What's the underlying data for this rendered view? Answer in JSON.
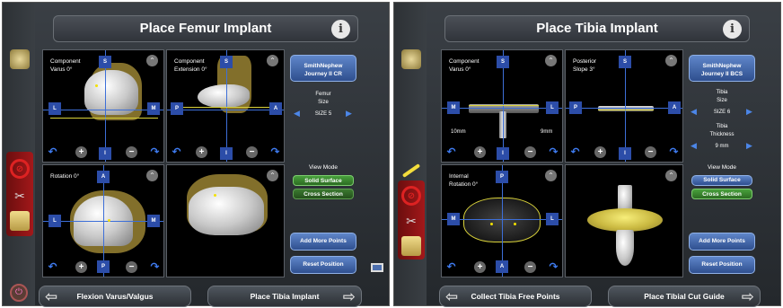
{
  "screens": [
    {
      "title": "Place Femur Implant",
      "implant": {
        "brand": "SmithNephew",
        "model": "Journey II CR"
      },
      "views": {
        "top_left": {
          "label": "Component\nVarus 0°",
          "axis_labels": [
            "S",
            "L",
            "M",
            "I"
          ]
        },
        "top_right": {
          "label": "Component\nExtension  0°",
          "axis_labels": [
            "S",
            "P",
            "A",
            "I"
          ]
        },
        "bottom_left": {
          "label": "Rotation 0°",
          "axis_labels": [
            "A",
            "L",
            "M",
            "P"
          ]
        }
      },
      "size_panel": {
        "title": "Femur\nSize",
        "value": "SIZE 5"
      },
      "view_mode": {
        "title": "View Mode",
        "options": [
          "Solid Surface",
          "Cross Section"
        ],
        "selected": "Solid Surface"
      },
      "buttons": {
        "add_points": "Add More Points",
        "reset": "Reset Position"
      },
      "nav": {
        "back": "Flexion Varus/Valgus",
        "next": "Place Tibia Implant"
      }
    },
    {
      "title": "Place Tibia Implant",
      "implant": {
        "brand": "SmithNephew",
        "model": "Journey II BCS"
      },
      "views": {
        "top_left": {
          "label": "Component\nVarus 0°",
          "axis_labels": [
            "S",
            "M",
            "L",
            "I"
          ],
          "left_mm": "10mm",
          "right_mm": "9mm"
        },
        "top_right": {
          "label": "Posterior\nSlope 3°",
          "axis_labels": [
            "S",
            "P",
            "A",
            "I"
          ]
        },
        "bottom_left": {
          "label": "Internal\nRotation 0°",
          "axis_labels": [
            "P",
            "M",
            "L",
            "A"
          ]
        }
      },
      "size_panel": {
        "title": "Tibia\nSize",
        "value": "SIZE 6",
        "thickness_title": "Tibia\nThickness",
        "thickness_value": "9 mm"
      },
      "view_mode": {
        "title": "View Mode",
        "options": [
          "Solid Surface",
          "Cross Section"
        ],
        "selected": "Cross Section"
      },
      "buttons": {
        "add_points": "Add More Points",
        "reset": "Reset Position"
      },
      "nav": {
        "back": "Collect Tibia Free Points",
        "next": "Place Tibial Cut Guide"
      }
    }
  ],
  "icons": {
    "info": "i",
    "collapse": "⌃",
    "plus": "+",
    "minus": "−",
    "rotate_ccw": "↶",
    "rotate_cw": "↷",
    "left_arrow": "◀",
    "right_arrow": "▶",
    "nav_left": "⇦",
    "nav_right": "⇨",
    "power": "⏻"
  },
  "colors": {
    "accent_blue": "#3d6fd8",
    "button_blue": "#2f4f8f",
    "active_green": "#48a13c",
    "implant_yellow": "#d9d23a"
  }
}
